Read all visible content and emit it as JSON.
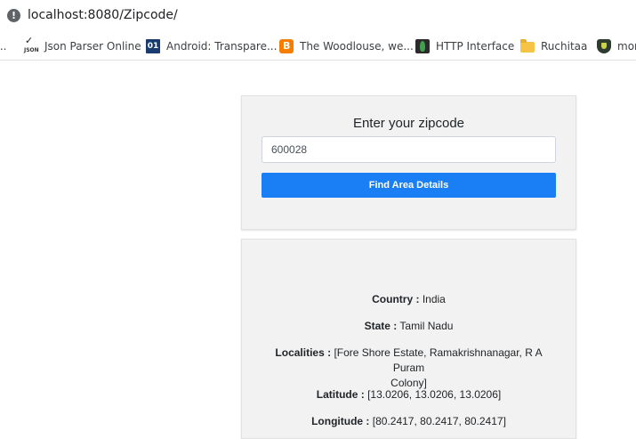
{
  "browser": {
    "url": "localhost:8080/Zipcode/",
    "bookmarks": [
      {
        "label": "...",
        "icon": "truncated-bookmark-icon"
      },
      {
        "label": "Json Parser Online",
        "icon": "json-icon"
      },
      {
        "label": "Android: Transpare...",
        "icon": "android-01-icon"
      },
      {
        "label": "The Woodlouse, we...",
        "icon": "blogger-icon"
      },
      {
        "label": "HTTP Interface",
        "icon": "mongodb-leaf-icon"
      },
      {
        "label": "Ruchitaa",
        "icon": "folder-icon"
      },
      {
        "label": "mor",
        "icon": "shield-icon"
      }
    ]
  },
  "form": {
    "title": "Enter your zipcode",
    "zipcode_value": "600028",
    "button_label": "Find Area Details"
  },
  "result": {
    "country_label": "Country :",
    "country_value": "India",
    "state_label": "State :",
    "state_value": "Tamil Nadu",
    "localities_label": "Localities :",
    "localities_value_line1": "[Fore Shore Estate, Ramakrishnanagar, R A Puram",
    "localities_value_line2": "Colony]",
    "latitude_label": "Latitude :",
    "latitude_value": "[13.0206, 13.0206, 13.0206]",
    "longitude_label": "Longitude :",
    "longitude_value": "[80.2417, 80.2417, 80.2417]"
  },
  "colors": {
    "button": "#1a7ff5",
    "card_background": "#f2f2f2"
  }
}
